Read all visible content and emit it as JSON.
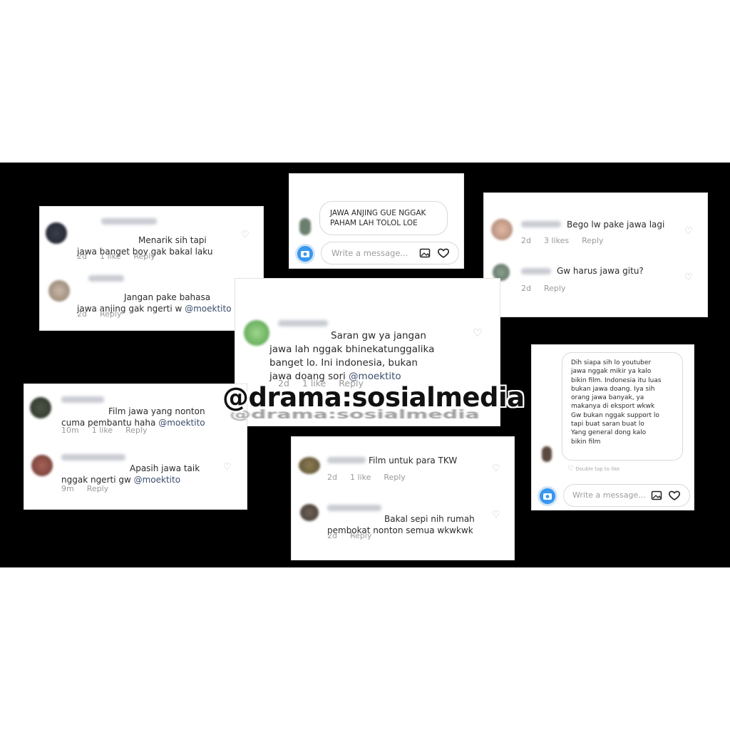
{
  "watermark": "@drama:sosialmedia",
  "cards": {
    "c1": {
      "comments": [
        {
          "text": "Menarik sih tapi\njawa banget boy gak bakal laku",
          "time": "2d",
          "likes": "1 like",
          "reply": "Reply"
        },
        {
          "text": "Jangan pake bahasa\njawa anjing gak ngerti w ",
          "mention": "@moektito",
          "time": "2d",
          "reply": "Reply"
        }
      ]
    },
    "c2": {
      "message": "JAWA ANJING GUE NGGAK\nPAHAM LAH TOLOL LOE",
      "placeholder": "Write a message..."
    },
    "c3": {
      "comments": [
        {
          "text": "Bego lw pake jawa lagi",
          "time": "2d",
          "likes": "3 likes",
          "reply": "Reply"
        },
        {
          "text": "Gw harus jawa gitu?",
          "time": "2d",
          "reply": "Reply"
        }
      ]
    },
    "c4": {
      "comment": {
        "text": "Saran gw ya jangan\njawa lah nggak bhinekatunggalika\nbanget lo. Ini indonesia, bukan\njawa doang sori ",
        "mention": "@moektito",
        "time": "2d",
        "likes": "1 like",
        "reply": "Reply"
      }
    },
    "c5": {
      "comments": [
        {
          "text": "Film jawa yang nonton\ncuma pembantu haha ",
          "mention": "@moektito",
          "time": "10m",
          "likes": "1 like",
          "reply": "Reply"
        },
        {
          "text": "Apasih jawa taik\nnggak ngerti gw ",
          "mention": "@moektito",
          "time": "9m",
          "reply": "Reply"
        }
      ]
    },
    "c6": {
      "comments": [
        {
          "text": "Film untuk para TKW",
          "time": "2d",
          "likes": "1 like",
          "reply": "Reply"
        },
        {
          "text": "Bakal sepi nih rumah\npembokat nonton semua wkwkwk",
          "time": "2d",
          "reply": "Reply"
        }
      ]
    },
    "c7": {
      "message": "Dih siapa sih lo youtuber\njawa nggak mikir ya kalo\nbikin film. Indonesia itu luas\nbukan jawa doang. Iya sih\norang jawa banyak, ya\nmakanya di eksport wkwk\nGw bukan nggak support lo\ntapi buat saran buat lo\nYang general dong kalo\nbikin film",
      "hint": "Double tap to like",
      "placeholder": "Write a message..."
    }
  },
  "colors": {
    "band": "#000000",
    "accent": "#3897f0",
    "mention": "#3b4d6b"
  }
}
